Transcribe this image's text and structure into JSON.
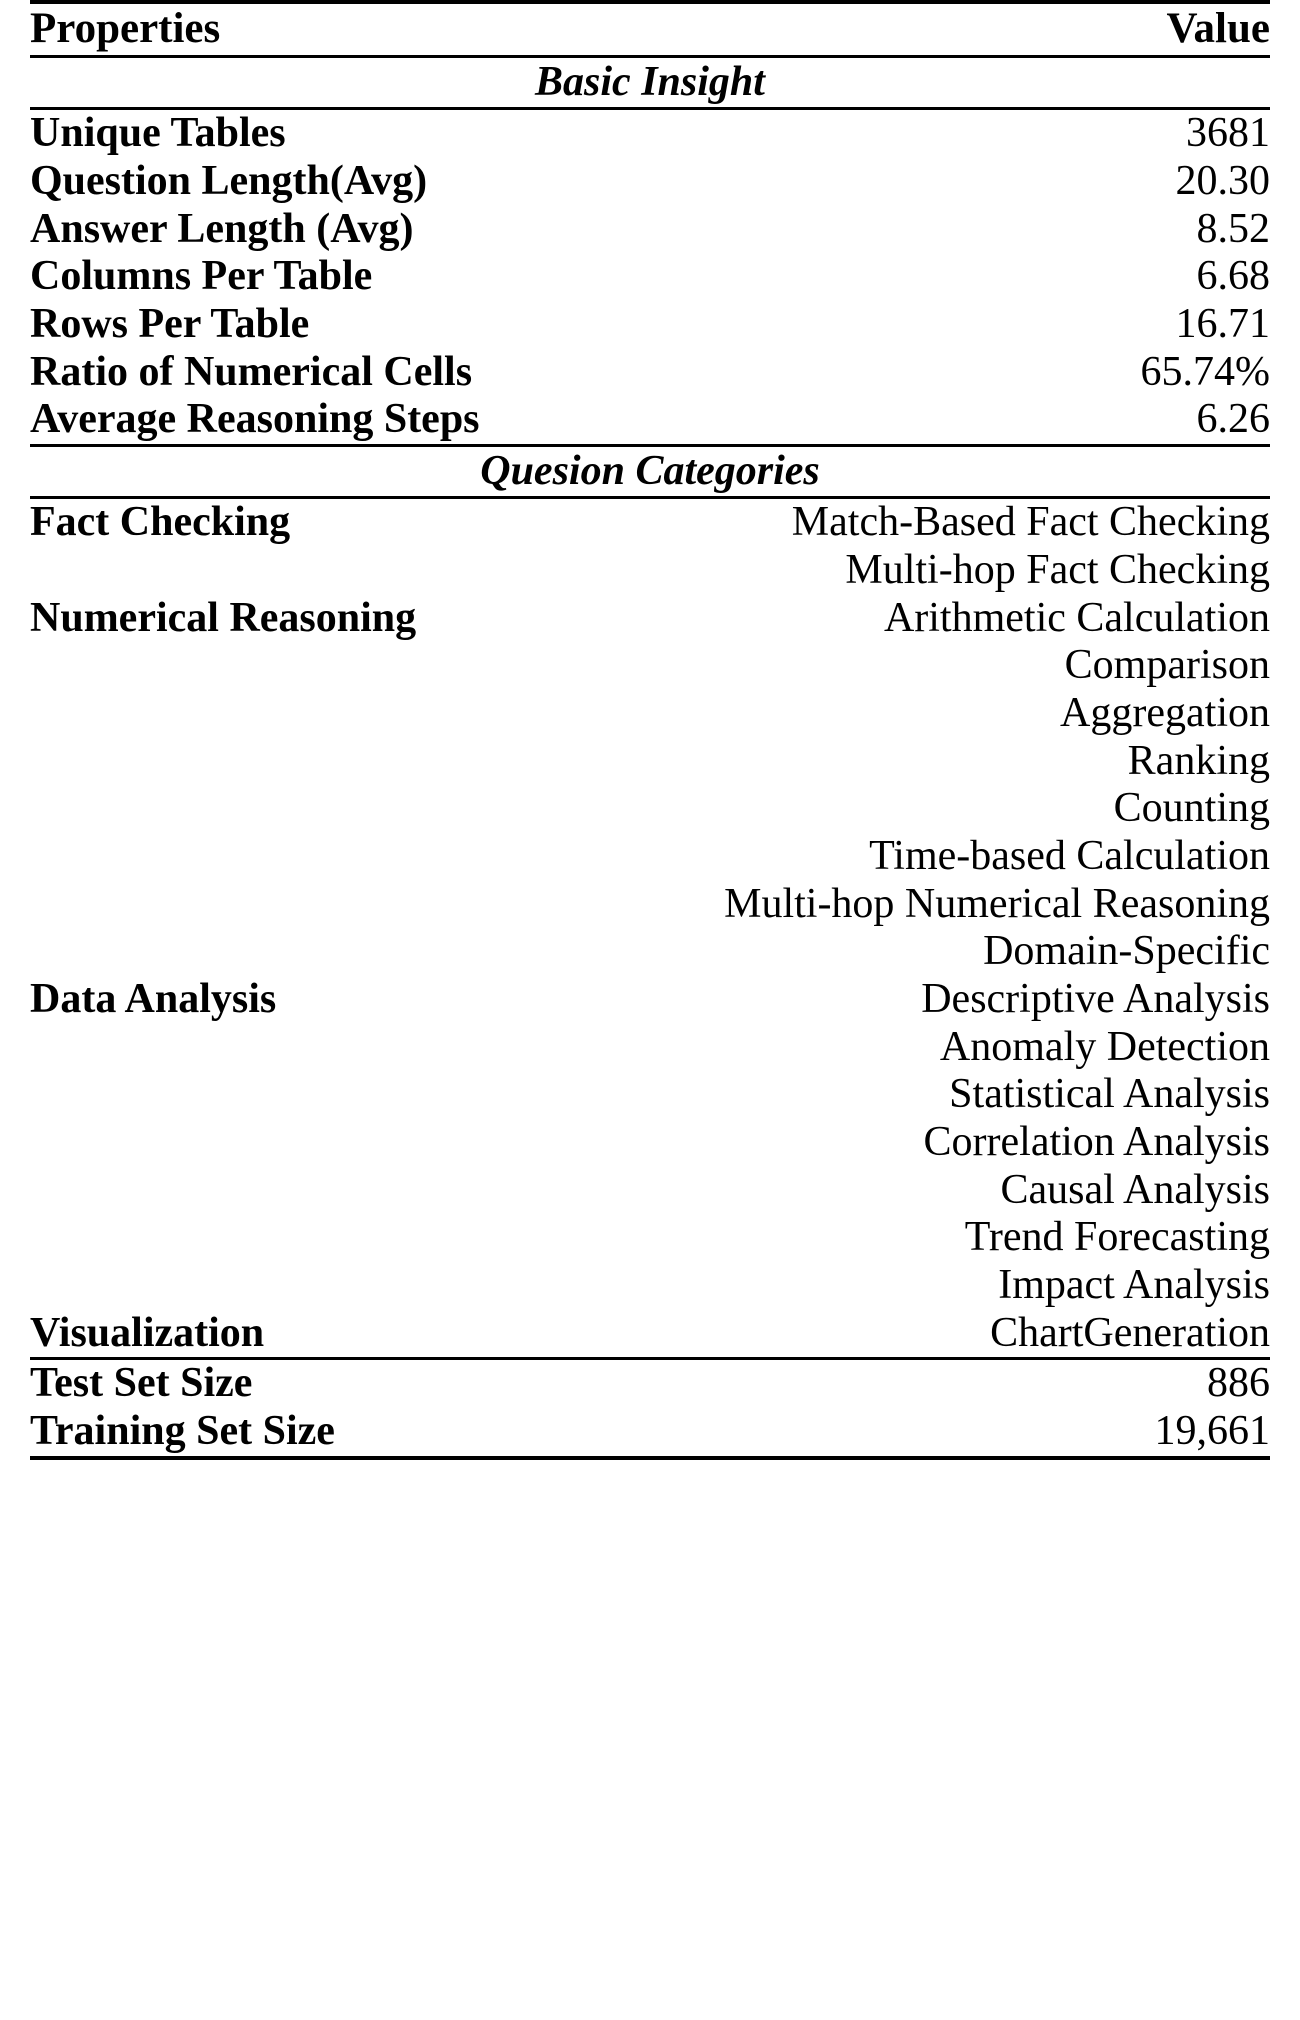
{
  "table": {
    "header": {
      "properties_label": "Properties",
      "value_label": "Value"
    },
    "sections": [
      {
        "title": "Basic Insight",
        "rows": [
          {
            "property": "Unique Tables",
            "value": "3681"
          },
          {
            "property": "Question Length(Avg)",
            "value": "20.30"
          },
          {
            "property": "Answer Length (Avg)",
            "value": "8.52"
          },
          {
            "property": "Columns Per Table",
            "value": "6.68"
          },
          {
            "property": "Rows Per Table",
            "value": "16.71"
          },
          {
            "property": "Ratio of Numerical Cells",
            "value": "65.74%"
          },
          {
            "property": "Average Reasoning Steps",
            "value": "6.26"
          }
        ]
      },
      {
        "title": "Quesion Categories",
        "rows": [
          {
            "property": "Fact Checking",
            "value": "Match-Based Fact Checking"
          },
          {
            "property": "",
            "value": "Multi-hop Fact Checking"
          },
          {
            "property": "Numerical Reasoning",
            "value": "Arithmetic Calculation"
          },
          {
            "property": "",
            "value": "Comparison"
          },
          {
            "property": "",
            "value": "Aggregation"
          },
          {
            "property": "",
            "value": "Ranking"
          },
          {
            "property": "",
            "value": "Counting"
          },
          {
            "property": "",
            "value": "Time-based Calculation"
          },
          {
            "property": "",
            "value": "Multi-hop Numerical Reasoning"
          },
          {
            "property": "",
            "value": "Domain-Specific"
          },
          {
            "property": "Data Analysis",
            "value": "Descriptive Analysis"
          },
          {
            "property": "",
            "value": "Anomaly Detection"
          },
          {
            "property": "",
            "value": "Statistical Analysis"
          },
          {
            "property": "",
            "value": "Correlation Analysis"
          },
          {
            "property": "",
            "value": "Causal Analysis"
          },
          {
            "property": "",
            "value": "Trend Forecasting"
          },
          {
            "property": "",
            "value": "Impact Analysis"
          },
          {
            "property": "Visualization",
            "value": "ChartGeneration"
          }
        ]
      },
      {
        "title": "",
        "rows": [
          {
            "property": "Test Set Size",
            "value": "886"
          },
          {
            "property": "Training Set Size",
            "value": "19,661"
          }
        ]
      }
    ]
  }
}
